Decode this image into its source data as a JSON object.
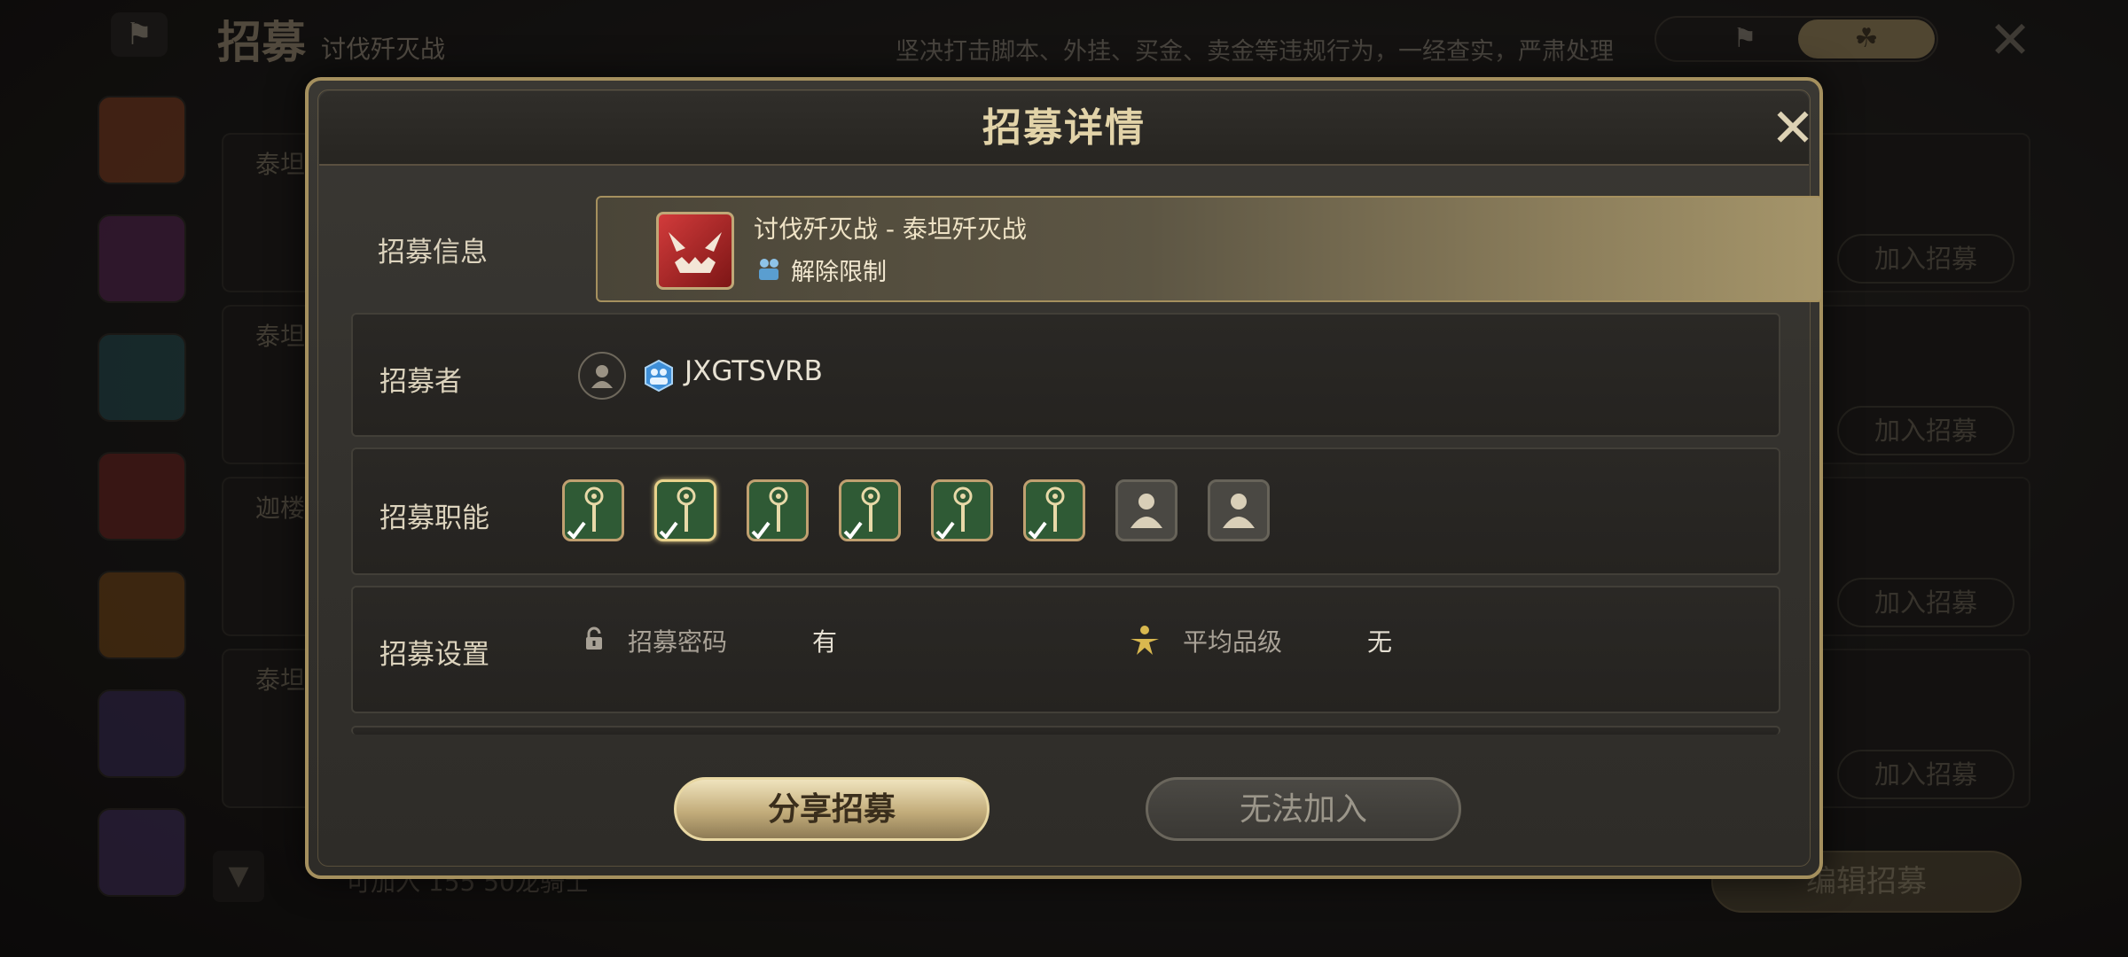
{
  "background": {
    "title": "招募",
    "subtitle": "讨伐歼灭战",
    "notice": "坚决打击脚本、外挂、买金、卖金等违规行为，一经查实，严肃处理",
    "list_items": [
      {
        "name": "泰坦",
        "join_label": "加入招募"
      },
      {
        "name": "泰坦",
        "join_label": "加入招募"
      },
      {
        "name": "迦楼",
        "join_label": "加入招募"
      },
      {
        "name": "泰坦",
        "join_label": "加入招募"
      }
    ],
    "footer_text": "可加入  155  50龙骑士",
    "edit_button": "编辑招募"
  },
  "modal": {
    "title": "招募详情",
    "info": {
      "label": "招募信息",
      "name": "讨伐歼灭战 - 泰坦歼灭战",
      "limit": "解除限制"
    },
    "recruiter": {
      "label": "招募者",
      "name": "JXGTSVRB"
    },
    "jobs": {
      "label": "招募职能",
      "slots": [
        {
          "type": "healer",
          "checked": true
        },
        {
          "type": "healer",
          "checked": true,
          "selected": true
        },
        {
          "type": "healer",
          "checked": true
        },
        {
          "type": "healer",
          "checked": true
        },
        {
          "type": "healer",
          "checked": true
        },
        {
          "type": "healer",
          "checked": true
        },
        {
          "type": "empty",
          "checked": false
        },
        {
          "type": "empty",
          "checked": false
        }
      ]
    },
    "settings": {
      "label": "招募设置",
      "password_label": "招募密码",
      "password_value": "有",
      "avg_level_label": "平均品级",
      "avg_level_value": "无"
    },
    "share_button": "分享招募",
    "join_button": "无法加入"
  },
  "colors": {
    "accent_gold": "#a5905e",
    "title_gold": "#e2d3a8",
    "job_green": "#2f5a35"
  }
}
